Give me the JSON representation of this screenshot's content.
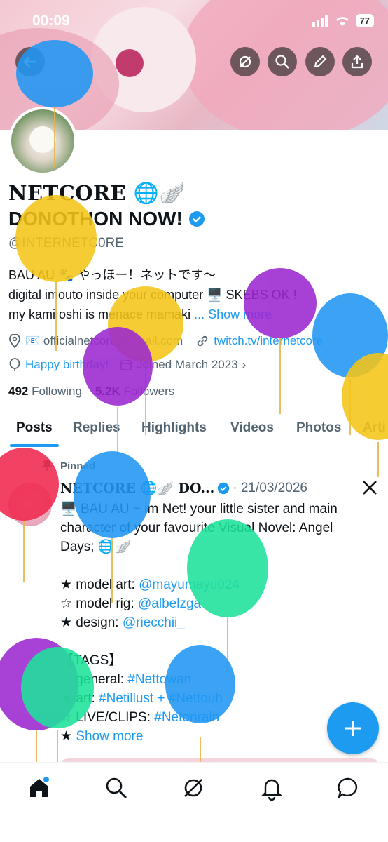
{
  "status_bar": {
    "time": "00:09",
    "battery": "77"
  },
  "profile": {
    "name_line1": "NETCORE 🌐🪽",
    "name_line2": "DONOTHON NOW!",
    "handle": "@INTERNETC0RE",
    "bio_line1": "BAU AU 🐾 やっほー！ネットです〜",
    "bio_line2": "digital imouto inside your computer 🖥️ SKEBS OK !",
    "bio_line3_text": "my kami oshi is menace mamaki ",
    "bio_more": "... Show more",
    "email": "📧 officialnetcore@gmail.com",
    "link": "twitch.tv/internetcore",
    "birthday": "Happy birthday!",
    "joined": "Joined March 2023",
    "following_count": "492",
    "following_label": "Following",
    "followers_count": "5.2K",
    "followers_label": "Followers"
  },
  "tabs": [
    "Posts",
    "Replies",
    "Highlights",
    "Videos",
    "Photos",
    "Arti"
  ],
  "post": {
    "pinned_label": "Pinned",
    "author": "NETCORE 🌐🪽 DO...",
    "date": "· 21/03/2026",
    "line1": "🖥️ BAU AU ~ im Net! your little sister and main",
    "line2": "character of your favourite Visual Novel: Angel",
    "line3": "Days; 🌐🪽",
    "art_label": "★ model art: ",
    "art_link": "@mayumayu024",
    "rig_label": "☆ model rig: ",
    "rig_link": "@albelzga",
    "design_label": "★ design: ",
    "design_link": "@riecchii_",
    "tags_header": "【TAGS】",
    "general_label": "☆ general: ",
    "general_link": "#Nettowan",
    "art2_label": "★ art: ",
    "art2_link": "#Netillust + #Nettouh",
    "live_label": "☆ LIVE/CLIPS: ",
    "live_link": "#Netonrain",
    "show_more_prefix": "★ ",
    "show_more": "Show more"
  },
  "icons": {
    "back": "back-arrow-icon",
    "grok": "grok-icon",
    "search": "search-icon",
    "edit": "pencil-icon",
    "share": "share-icon",
    "x_logo": "x-logo-icon",
    "compose": "plus-icon"
  },
  "colors": {
    "accent": "#1d9bf0",
    "text": "#0f1419",
    "muted": "#536471"
  }
}
